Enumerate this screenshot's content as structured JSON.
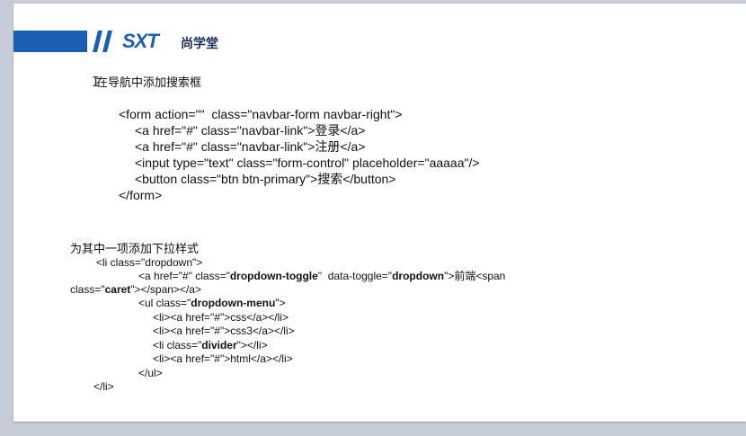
{
  "logo": {
    "text": "SXT",
    "cn": "尚学堂"
  },
  "section1": {
    "heading": "在导航中添加搜索框",
    "lines": [
      "<form action=\"\"  class=\"navbar-form navbar-right\">",
      "<a href=\"#\" class=\"navbar-link\">登录</a>",
      "<a href=\"#\" class=\"navbar-link\">注册</a>",
      "<input type=\"text\" class=\"form-control\" placeholder=\"aaaaa\"/>",
      "<button class=\"btn btn-primary\">搜索</button>",
      "</form>"
    ]
  },
  "section2": {
    "heading": "为其中一项添加下拉样式",
    "l1": "<li class=\"dropdown\">",
    "l2a": "<a href=\"#\" class=\"",
    "l2b": "dropdown-toggle",
    "l2c": "\"  data-toggle=\"",
    "l2d": "dropdown",
    "l2e": "\">前端<span",
    "l3a": "class=\"",
    "l3b": "caret",
    "l3c": "\"></span></a>",
    "l4a": "<ul class=\"",
    "l4b": "dropdown-menu",
    "l4c": "\">",
    "l5": "<li><a href=\"#\">css</a></li>",
    "l6": "<li><a href=\"#\">css3</a></li>",
    "l7a": "<li class=\"",
    "l7b": "divider",
    "l7c": "\"></li>",
    "l8": "<li><a href=\"#\">html</a></li>",
    "l9": "</ul>",
    "l10": "</li>"
  }
}
